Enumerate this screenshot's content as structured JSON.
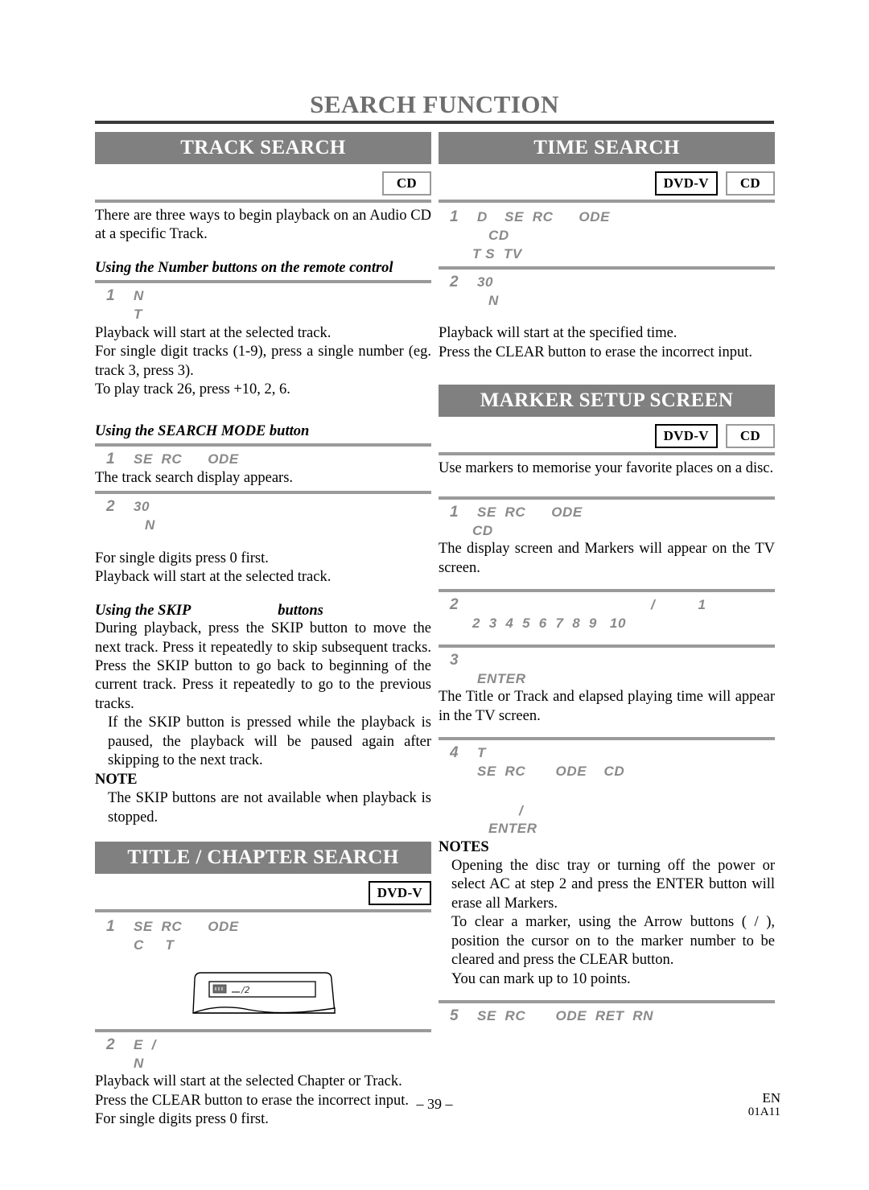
{
  "page": {
    "title": "SEARCH FUNCTION",
    "footer_page_number": "– 39 –",
    "footer_lang": "EN",
    "footer_code": "01A11"
  },
  "badges": {
    "cd": "CD",
    "dvd_v": "DVD-V"
  },
  "sections": {
    "track_search": {
      "heading": "TRACK SEARCH",
      "intro": "There are three ways to begin playback on an Audio CD at a specific Track.",
      "sub1_heading": "Using the Number buttons on the remote control",
      "sub1_step1_num": "1",
      "sub1_step1_text": "N",
      "sub1_step1_sub": "T",
      "sub1_body1": "Playback will start at the selected track.",
      "sub1_body2": "For single digit tracks (1-9), press a single number (eg. track 3, press 3).",
      "sub1_body3": "To play track 26, press +10, 2, 6.",
      "sub2_heading": "Using the SEARCH MODE button",
      "sub2_step1_num": "1",
      "sub2_step1_text": "SE  RC      ODE",
      "sub2_step1_body": "The track search display appears.",
      "sub2_step2_num": "2",
      "sub2_step2_text": "30",
      "sub2_step2_sub": "N",
      "sub2_body1": "For single digits press 0 first.",
      "sub2_body2": "Playback will start at the selected track.",
      "sub3_heading_a": "Using the SKIP",
      "sub3_heading_b": "buttons",
      "sub3_body": "During playback, press the SKIP        button to move the next track. Press it repeatedly to skip subsequent tracks. Press the SKIP        button to go back to beginning of the current track. Press it repeatedly to go to the previous tracks.",
      "sub3_body2": "If the SKIP button is pressed while the playback is paused, the playback will be paused again after skipping to the next track.",
      "note_heading": "NOTE",
      "note_body": "The SKIP            buttons are not available when playback is stopped."
    },
    "title_chapter_search": {
      "heading": "TITLE / CHAPTER SEARCH",
      "step1_num": "1",
      "step1_text": "SE  RC      ODE",
      "step1_sub": "C     T",
      "step2_num": "2",
      "step2_text": "E  /",
      "step2_sub": "N",
      "body1": "Playback will start at the selected Chapter or Track.",
      "body2": "Press the CLEAR button to erase the incorrect input.",
      "body3": "For single digits press 0 first."
    },
    "time_search": {
      "heading": "TIME SEARCH",
      "step1_num": "1",
      "step1_text": "D    SE  RC      ODE",
      "step1_sub1": "CD",
      "step1_sub2": "T S  TV",
      "step2_num": "2",
      "step2_text": "30",
      "step2_sub": "N",
      "body1": "Playback will start at the specified time.",
      "body2": "Press the CLEAR button to erase the incorrect input."
    },
    "marker_setup_screen": {
      "heading": "MARKER SETUP SCREEN",
      "intro": "Use markers to memorise your favorite places on a disc.",
      "step1_num": "1",
      "step1_text": "SE  RC      ODE",
      "step1_sub": "CD",
      "step1_body": "The display screen and Markers will appear on the TV screen.",
      "step2_num": "2",
      "step2_text": "/          1",
      "step2_sub": "2  3  4  5  6  7  8  9   10",
      "step3_num": "3",
      "step3_text": "",
      "step3_sub": "ENTER",
      "step3_body": "The Title or Track and elapsed playing time will appear in the TV screen.",
      "step4_num": "4",
      "step4_text": "T",
      "step4_sub1": "SE  RC       ODE    CD",
      "step4_sub2": "/",
      "step4_sub3": "ENTER",
      "notes_heading": "NOTES",
      "notes_body1": "Opening the disc tray or turning off the power or select AC at step 2 and press the ENTER button will erase all Markers.",
      "notes_body2": "To clear a marker, using the Arrow buttons (    /    ), position the cursor on to the marker number to be cleared and press the CLEAR button.",
      "notes_body3": "You can mark up to 10 points.",
      "step5_num": "5",
      "step5_text": "SE  RC       ODE  RET  RN"
    }
  }
}
